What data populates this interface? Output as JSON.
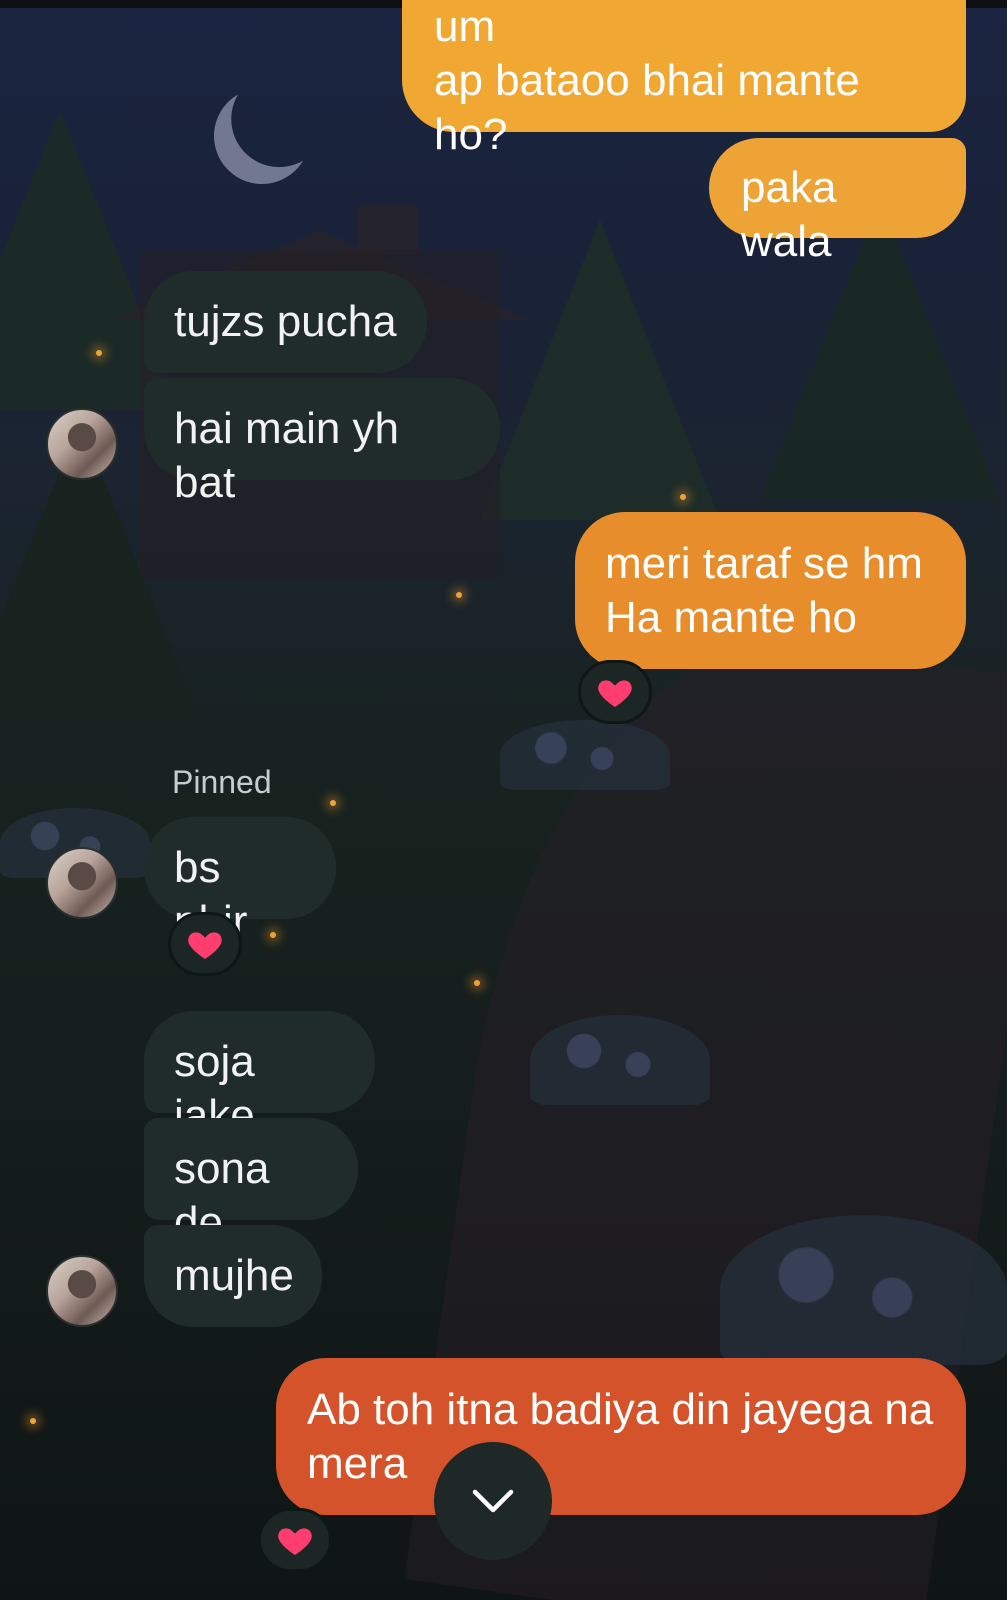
{
  "chat": {
    "pinned_label": "Pinned",
    "messages": [
      {
        "id": "m1",
        "direction": "outgoing",
        "lines": [
          "um",
          "ap bataoo bhai mante ho?"
        ]
      },
      {
        "id": "m2",
        "direction": "outgoing",
        "lines": [
          "paka wala"
        ]
      },
      {
        "id": "m3",
        "direction": "incoming",
        "lines": [
          "tujzs pucha"
        ]
      },
      {
        "id": "m4",
        "direction": "incoming",
        "lines": [
          "hai main yh bat"
        ]
      },
      {
        "id": "m5",
        "direction": "outgoing",
        "lines": [
          "meri taraf se hm",
          "Ha mante ho"
        ],
        "reaction": "heart"
      },
      {
        "id": "m6",
        "direction": "incoming",
        "lines": [
          "bs phir"
        ],
        "pinned": true,
        "reaction": "heart"
      },
      {
        "id": "m7",
        "direction": "incoming",
        "lines": [
          "soja jake"
        ]
      },
      {
        "id": "m8",
        "direction": "incoming",
        "lines": [
          "sona de"
        ]
      },
      {
        "id": "m9",
        "direction": "incoming",
        "lines": [
          "mujhe"
        ]
      },
      {
        "id": "m10",
        "direction": "outgoing",
        "lines": [
          "Ab toh itna badiya din jayega na",
          "mera"
        ],
        "reaction": "heart"
      }
    ]
  },
  "icons": {
    "reaction": "heart-icon",
    "scroll": "chevron-down-icon",
    "avatar": "avatar"
  },
  "colors": {
    "incoming_bubble": "#202c2a",
    "outgoing_gradient_top": "#f0a833",
    "outgoing_gradient_mid": "#e78d2c",
    "outgoing_gradient_bottom": "#d5532a",
    "heart": "#ff3d6e"
  }
}
